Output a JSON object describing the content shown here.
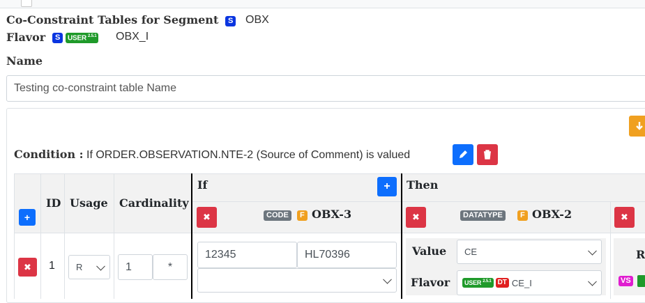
{
  "header": {
    "title": "Co-Constraint Tables for Segment",
    "segment_badge": "S",
    "segment_name": "OBX",
    "flavor_label": "Flavor",
    "flavor_s_badge": "S",
    "flavor_user_badge": "USER",
    "flavor_version": "2.5.1",
    "flavor_name": "OBX_I"
  },
  "name_section": {
    "label": "Name",
    "value": "Testing co-constraint table Name"
  },
  "condition": {
    "label": "Condition :",
    "text": "If ORDER.OBSERVATION.NTE-2 (Source of Comment) is valued"
  },
  "table": {
    "headers": {
      "id": "ID",
      "usage": "Usage",
      "cardinality": "Cardinality",
      "if": "If",
      "then": "Then",
      "r_partial": "R"
    },
    "if_column": {
      "code_badge": "CODE",
      "f_badge": "F",
      "field": "OBX-3"
    },
    "then_column": {
      "datatype_badge": "DATATYPE",
      "f_badge": "F",
      "field": "OBX-2"
    },
    "row": {
      "id": "1",
      "usage": "R",
      "card_min": "1",
      "card_max": "*",
      "code_value": "12345",
      "code_system": "HL70396",
      "code_location": "",
      "value_label": "Value",
      "value_select": "CE",
      "flavor_label": "Flavor",
      "flavor_user_badge": "USER",
      "flavor_version": "2.5.1",
      "flavor_dt_badge": "DT",
      "flavor_value": "CE_I",
      "vs_badge": "VS"
    }
  },
  "colors": {
    "s_badge": "#0a35e0",
    "user_badge": "#1f9a2a",
    "code_badge": "#6c757d",
    "f_badge": "#f0a020",
    "dt_badge": "#e02020",
    "vs_badge": "#e01dd0",
    "danger": "#dc3545",
    "primary": "#0d6efd"
  },
  "icons": {
    "remove": "times-icon",
    "add": "plus-icon",
    "edit": "pencil-icon",
    "delete": "trash-icon",
    "import": "arrow-down-icon",
    "dropdown": "chevron-down-icon"
  }
}
